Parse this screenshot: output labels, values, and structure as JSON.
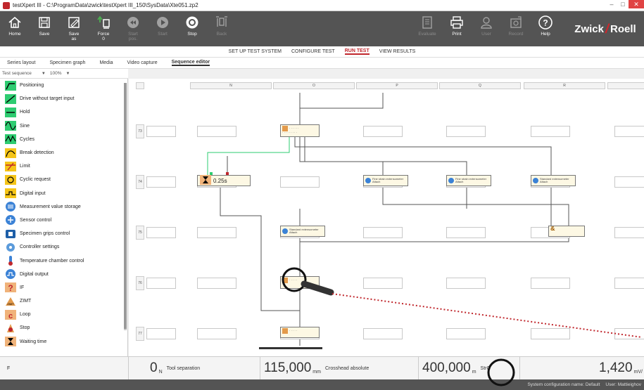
{
  "window": {
    "title": "testXpert III - C:\\ProgramData\\zwick\\testXpert III_150\\SysData\\Xte051.zp2"
  },
  "toolbar": {
    "left": [
      {
        "label": "Home",
        "icon": "home-icon"
      },
      {
        "label": "Save",
        "icon": "save-icon"
      },
      {
        "label": "Save\nas",
        "icon": "save-as-icon"
      },
      {
        "label": "Force\n0",
        "icon": "force-zero-icon"
      },
      {
        "label": "Start\npos.",
        "icon": "start-position-icon"
      },
      {
        "label": "Start",
        "icon": "start-icon"
      },
      {
        "label": "Stop",
        "icon": "stop-icon"
      },
      {
        "label": "Back",
        "icon": "back-icon"
      }
    ],
    "right": [
      {
        "label": "Evaluate",
        "icon": "evaluate-icon"
      },
      {
        "label": "Print",
        "icon": "print-icon"
      },
      {
        "label": "User",
        "icon": "user-icon"
      },
      {
        "label": "Record",
        "icon": "record-icon"
      },
      {
        "label": "Help",
        "icon": "help-icon"
      }
    ],
    "logo_left": "Zwick",
    "logo_right": "Roell"
  },
  "topnav": [
    "SET UP TEST SYSTEM",
    "CONFIGURE TEST",
    "RUN TEST",
    "VIEW RESULTS"
  ],
  "topnav_active": "RUN TEST",
  "subtabs": [
    "Series layout",
    "Specimen graph",
    "Media",
    "Video capture",
    "Sequence editor"
  ],
  "subtab_active": "Sequence editor",
  "selector": {
    "sequence": "Test sequence",
    "zoom": "100%"
  },
  "palette": [
    {
      "label": "Positioning",
      "icon": "positioning-icon"
    },
    {
      "label": "Drive without target input",
      "icon": "drive-icon"
    },
    {
      "label": "Hold",
      "icon": "hold-icon"
    },
    {
      "label": "Sine",
      "icon": "sine-icon"
    },
    {
      "label": "Cycles",
      "icon": "cycles-icon"
    },
    {
      "label": "Break detection",
      "icon": "break-detection-icon"
    },
    {
      "label": "Limit",
      "icon": "limit-icon"
    },
    {
      "label": "Cyclic request",
      "icon": "cyclic-request-icon"
    },
    {
      "label": "Digital input",
      "icon": "digital-input-icon"
    },
    {
      "label": "Measurement value storage",
      "icon": "measurement-storage-icon"
    },
    {
      "label": "Sensor control",
      "icon": "sensor-control-icon"
    },
    {
      "label": "Specimen grips control",
      "icon": "grips-control-icon"
    },
    {
      "label": "Controller settings",
      "icon": "controller-settings-icon"
    },
    {
      "label": "Temperature chamber control",
      "icon": "temperature-icon"
    },
    {
      "label": "Digital output",
      "icon": "digital-output-icon"
    },
    {
      "label": "IF",
      "icon": "if-icon"
    },
    {
      "label": "ZIMT",
      "icon": "zimt-icon"
    },
    {
      "label": "Loop",
      "icon": "loop-icon"
    },
    {
      "label": "Stop",
      "icon": "stop-block-icon"
    },
    {
      "label": "Waiting time",
      "icon": "waiting-time-icon"
    }
  ],
  "columns": [
    "N",
    "O",
    "P",
    "Q",
    "R",
    "S"
  ],
  "rows": [
    "73",
    "74",
    "75",
    "76",
    "77"
  ],
  "blocks": {
    "wait_value": "0.25s",
    "extensometer_fine_1": "Fine strain extensometer\nAttach",
    "extensometer_fine_2": "Fine strain extensometer\nAttach",
    "extensometer_std_1": "Standard extensometer\nAttach",
    "extensometer_std_2": "Standard extensometer\nAttach"
  },
  "status": {
    "channel": "F",
    "force_value": "0",
    "force_unit": "N",
    "force_label": "Tool separation",
    "crosshead_value": "115,000",
    "crosshead_unit": "mm",
    "crosshead_label": "Crosshead absolute",
    "strain_value": "400,000",
    "strain_unit": "m",
    "strain_label": "StrG",
    "rate_value": "1,420",
    "rate_unit": "mV/"
  },
  "info": {
    "config": "System configuration name: Default",
    "user": "User: Mattieighov"
  }
}
